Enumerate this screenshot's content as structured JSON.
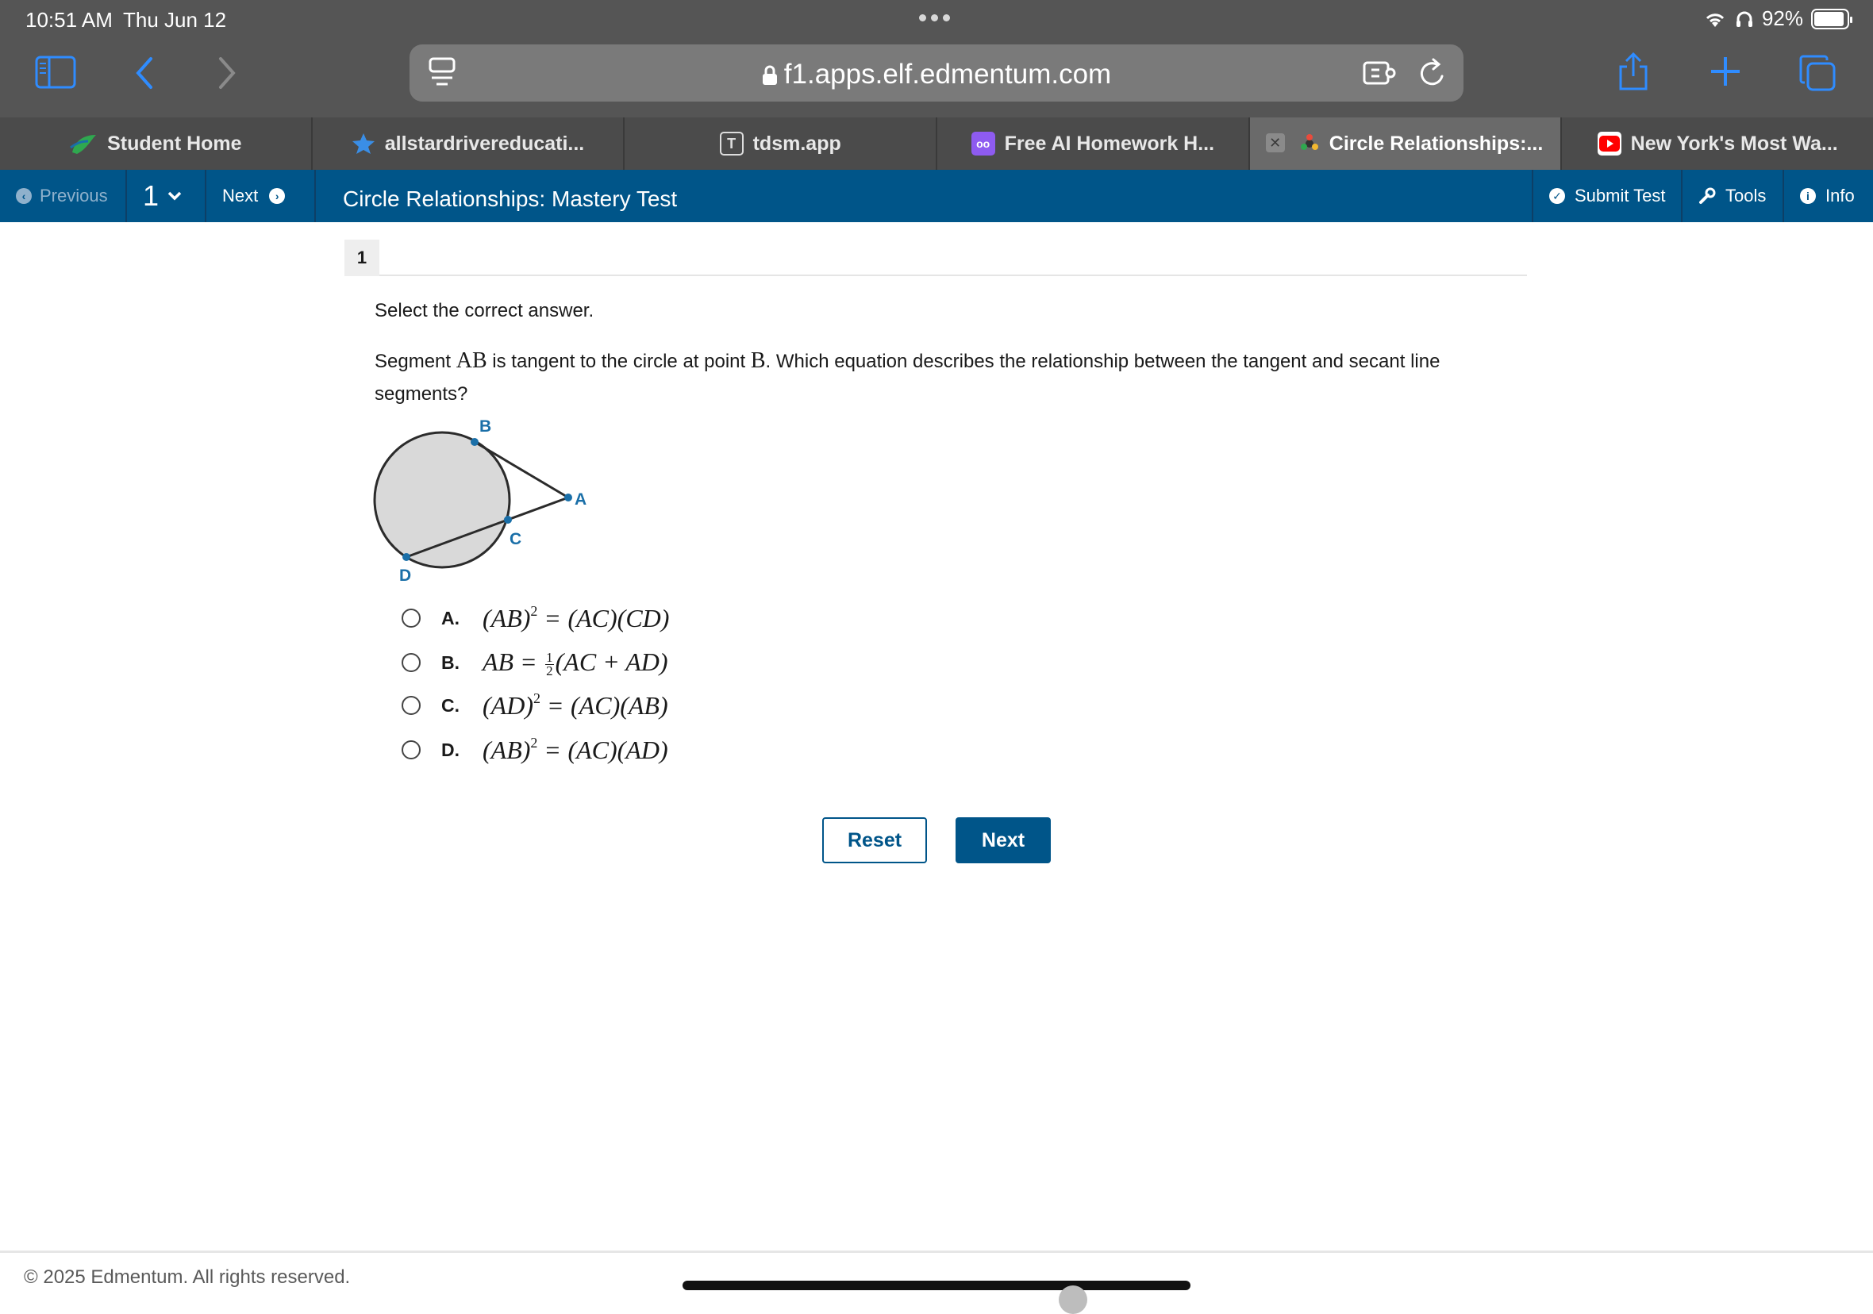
{
  "status": {
    "time": "10:51 AM",
    "date": "Thu Jun 12",
    "battery": "92%",
    "battery_level": 0.92
  },
  "browser": {
    "url": "f1.apps.elf.edmentum.com",
    "tabs": [
      {
        "label": "Student Home",
        "icon": "leaf-logo-icon"
      },
      {
        "label": "allstardrivereducati...",
        "icon": "star-icon"
      },
      {
        "label": "tdsm.app",
        "icon": "t-logo-icon"
      },
      {
        "label": "Free AI Homework H...",
        "icon": "owl-logo-icon"
      },
      {
        "label": "Circle Relationships:...",
        "icon": "edmentum-logo-icon",
        "active": true
      },
      {
        "label": "New York's Most Wa...",
        "icon": "youtube-icon"
      }
    ]
  },
  "nav": {
    "previous": "Previous",
    "question_number": "1",
    "next": "Next",
    "title": "Circle Relationships: Mastery Test",
    "submit": "Submit Test",
    "tools": "Tools",
    "info": "Info"
  },
  "question": {
    "number": "1",
    "instruction": "Select the correct answer.",
    "prompt_part1": "Segment ",
    "prompt_math1": "AB",
    "prompt_part2": " is tangent to the circle at point ",
    "prompt_math2": "B",
    "prompt_part3": ". Which equation describes the relationship between the tangent and secant line segments?",
    "figure_labels": {
      "b": "B",
      "a": "A",
      "c": "C",
      "d": "D"
    },
    "choices": [
      {
        "letter": "A.",
        "lhs": "(AB)",
        "exp": "2",
        "op": "=",
        "rhs": "(AC)(CD)"
      },
      {
        "letter": "B.",
        "lhs": "AB",
        "op": "=",
        "frac_num": "1",
        "frac_den": "2",
        "rhs": "(AC + AD)"
      },
      {
        "letter": "C.",
        "lhs": "(AD)",
        "exp": "2",
        "op": "=",
        "rhs": "(AC)(AB)"
      },
      {
        "letter": "D.",
        "lhs": "(AB)",
        "exp": "2",
        "op": "=",
        "rhs": "(AC)(AD)"
      }
    ]
  },
  "buttons": {
    "reset": "Reset",
    "next": "Next"
  },
  "footer": "© 2025 Edmentum. All rights reserved.",
  "colors": {
    "nav": "#005589",
    "accent": "#1a6fa8",
    "chrome": "#555555"
  }
}
